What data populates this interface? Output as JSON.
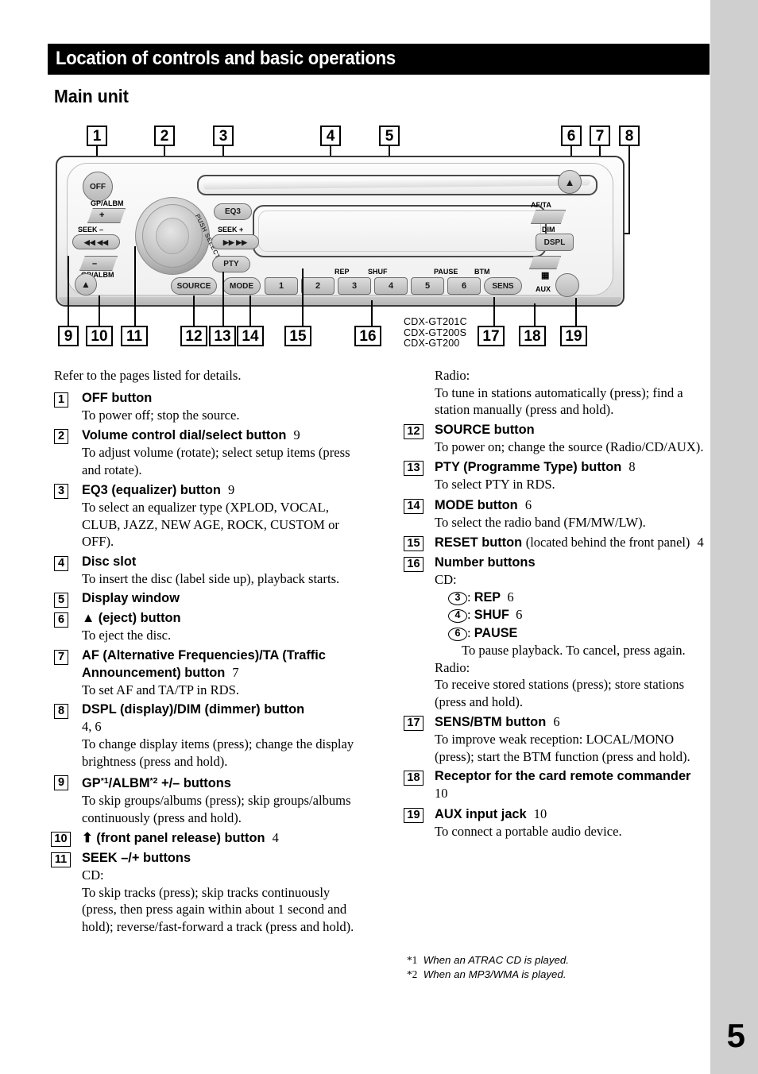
{
  "header": {
    "chapter_title": "Location of controls and basic operations",
    "section_title": "Main unit"
  },
  "device": {
    "model_numbers": "CDX-GT201C\nCDX-GT200S\nCDX-GT200",
    "buttons": {
      "off": "OFF",
      "eq3": "EQ3",
      "pty": "PTY",
      "source": "SOURCE",
      "mode": "MODE",
      "dspl": "DSPL",
      "sens": "SENS"
    },
    "labels": {
      "gp_albm_top": "GP/ALBM",
      "gp_albm_bottom": "GP/ALBM",
      "seek_minus": "SEEK –",
      "seek_plus": "SEEK +",
      "push_select": "PUSH SELECT",
      "af_ta": "AF/TA",
      "dim": "DIM",
      "aux": "AUX",
      "btm": "BTM",
      "rep": "REP",
      "shuf": "SHUF",
      "pause": "PAUSE"
    },
    "number_buttons": [
      "1",
      "2",
      "3",
      "4",
      "5",
      "6"
    ],
    "callouts_top": [
      "1",
      "2",
      "3",
      "4",
      "5",
      "6",
      "7",
      "8"
    ],
    "callouts_bottom": [
      "9",
      "10",
      "11",
      "12",
      "13",
      "14",
      "15",
      "16",
      "17",
      "18",
      "19"
    ]
  },
  "body": {
    "intro": "Refer to the pages listed for details.",
    "left_items": [
      {
        "num": "1",
        "title": "OFF button",
        "page": "",
        "lines": [
          "To power off; stop the source."
        ]
      },
      {
        "num": "2",
        "title": "Volume control dial/select button",
        "page": "9",
        "lines": [
          "To adjust volume (rotate); select setup items (press and rotate)."
        ]
      },
      {
        "num": "3",
        "title": "EQ3 (equalizer) button",
        "page": "9",
        "lines": [
          "To select an equalizer type (XPLOD, VOCAL, CLUB, JAZZ, NEW AGE, ROCK, CUSTOM or OFF)."
        ]
      },
      {
        "num": "4",
        "title": "Disc slot",
        "page": "",
        "lines": [
          "To insert the disc (label side up), playback starts."
        ]
      },
      {
        "num": "5",
        "title": "Display window",
        "page": "",
        "lines": []
      },
      {
        "num": "6",
        "title": "▲ (eject) button",
        "page": "",
        "lines": [
          "To eject the disc."
        ]
      },
      {
        "num": "7",
        "title": "AF (Alternative Frequencies)/TA (Traffic Announcement) button",
        "page": "7",
        "lines": [
          "To set AF and TA/TP in RDS."
        ]
      },
      {
        "num": "8",
        "title": "DSPL (display)/DIM (dimmer) button",
        "page": "4, 6",
        "lines": [
          "To change display items (press); change the display brightness (press and hold)."
        ]
      },
      {
        "num": "9",
        "title": "GP*1/ALBM*2 +/– buttons",
        "page": "",
        "lines": [
          "To skip groups/albums (press); skip groups/albums continuously (press and hold)."
        ]
      },
      {
        "num": "10",
        "title": "⬆ (front panel release) button",
        "page": "4",
        "lines": []
      },
      {
        "num": "11",
        "title": "SEEK –/+ buttons",
        "page": "",
        "lines": [
          "CD:",
          "To skip tracks (press); skip tracks continuously (press, then press again within about 1 second and hold); reverse/fast-forward a track (press and hold)."
        ]
      }
    ],
    "right_items": [
      {
        "num": "",
        "title": "",
        "page": "",
        "lines": [
          "Radio:",
          "To tune in stations automatically (press); find a station manually (press and hold)."
        ]
      },
      {
        "num": "12",
        "title": "SOURCE button",
        "page": "",
        "lines": [
          "To power on; change the source (Radio/CD/AUX)."
        ]
      },
      {
        "num": "13",
        "title": "PTY (Programme Type) button",
        "page": "8",
        "lines": [
          "To select PTY in RDS."
        ]
      },
      {
        "num": "14",
        "title": "MODE button",
        "page": "6",
        "lines": [
          "To select the radio band (FM/MW/LW)."
        ]
      },
      {
        "num": "15",
        "title": "RESET button",
        "title_suffix": "(located behind the front panel)",
        "page": "4",
        "lines": []
      },
      {
        "num": "16",
        "title": "Number buttons",
        "page": "",
        "lines": [
          "CD:"
        ],
        "entries": [
          {
            "key": "3",
            "label": "REP",
            "page": "6"
          },
          {
            "key": "4",
            "label": "SHUF",
            "page": "6"
          },
          {
            "key": "6",
            "label": "PAUSE",
            "page": ""
          }
        ],
        "entry_note": "To pause playback. To cancel, press again.",
        "tail_lines": [
          "Radio:",
          "To receive stored stations (press); store stations (press and hold)."
        ]
      },
      {
        "num": "17",
        "title": "SENS/BTM button",
        "page": "6",
        "lines": [
          "To improve weak reception: LOCAL/MONO (press); start the BTM function (press and hold)."
        ]
      },
      {
        "num": "18",
        "title": "Receptor for the card remote commander",
        "page": "10",
        "lines": []
      },
      {
        "num": "19",
        "title": "AUX input jack",
        "page": "10",
        "lines": [
          "To connect a portable audio device."
        ]
      }
    ],
    "footnotes": [
      {
        "mark": "*1",
        "text": "When an ATRAC CD is played."
      },
      {
        "mark": "*2",
        "text": "When an MP3/WMA is played."
      }
    ]
  },
  "page_number": "5"
}
